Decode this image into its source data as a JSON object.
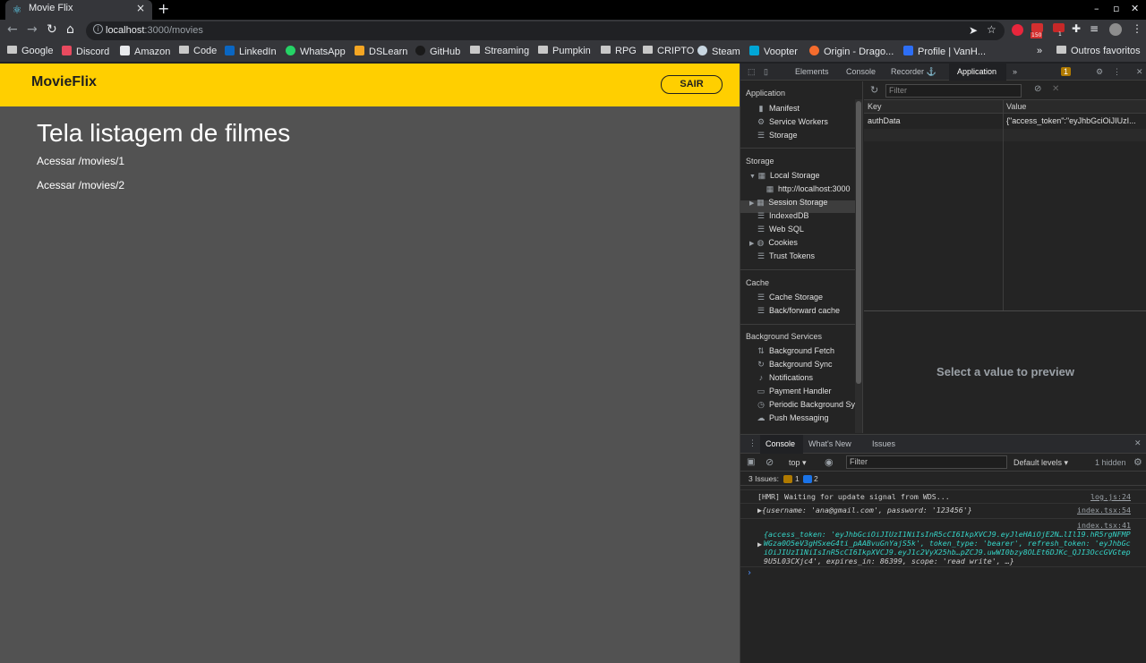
{
  "browser": {
    "tab_title": "Movie Flix",
    "new_tab": "+",
    "close_tab": "×",
    "url_host": "localhost",
    "url_path": ":3000/movies",
    "window_controls": [
      "–",
      "▫",
      "✕"
    ],
    "extension_badges": [
      "150",
      "1"
    ]
  },
  "bookmarks": [
    {
      "label": "Google",
      "icon": "folder"
    },
    {
      "label": "Discord",
      "icon": "discord-icon",
      "color": "#e84a5f"
    },
    {
      "label": "Amazon",
      "icon": "amazon-icon",
      "color": "#e8eaed"
    },
    {
      "label": "Code",
      "icon": "folder"
    },
    {
      "label": "LinkedIn",
      "icon": "linkedin-icon",
      "color": "#0a66c2"
    },
    {
      "label": "WhatsApp",
      "icon": "whatsapp-icon",
      "color": "#25d366"
    },
    {
      "label": "DSLearn",
      "icon": "bolt-icon",
      "color": "#f5a623"
    },
    {
      "label": "GitHub",
      "icon": "github-icon",
      "color": "#222"
    },
    {
      "label": "Streaming",
      "icon": "folder"
    },
    {
      "label": "Pumpkin",
      "icon": "folder"
    },
    {
      "label": "RPG",
      "icon": "folder"
    },
    {
      "label": "CRIPTO",
      "icon": "folder"
    },
    {
      "label": "Steam",
      "icon": "steam-icon",
      "color": "#1b2838"
    },
    {
      "label": "Voopter",
      "icon": "voopter-icon",
      "color": "#00a6d6"
    },
    {
      "label": "Origin - Drago...",
      "icon": "origin-icon",
      "color": "#f56c2d"
    },
    {
      "label": "Profile | VanH...",
      "icon": "vanh-icon",
      "color": "#2d6ef5"
    }
  ],
  "bookmarks_more": "»",
  "bookmarks_other": "Outros favoritos",
  "page": {
    "brand": "MovieFlix",
    "logout": "SAIR",
    "heading": "Tela listagem de filmes",
    "links": [
      "Acessar /movies/1",
      "Acessar /movies/2"
    ]
  },
  "devtools": {
    "tabs": [
      "Elements",
      "Console",
      "Recorder ⚓",
      "Application",
      "»"
    ],
    "issue_count": "1",
    "sidebar": {
      "application_title": "Application",
      "application_items": [
        "Manifest",
        "Service Workers",
        "Storage"
      ],
      "storage_title": "Storage",
      "storage_items": [
        "Local Storage",
        "http://localhost:3000",
        "Session Storage",
        "IndexedDB",
        "Web SQL",
        "Cookies",
        "Trust Tokens"
      ],
      "cache_title": "Cache",
      "cache_items": [
        "Cache Storage",
        "Back/forward cache"
      ],
      "background_title": "Background Services",
      "background_items": [
        "Background Fetch",
        "Background Sync",
        "Notifications",
        "Payment Handler",
        "Periodic Background Sync",
        "Push Messaging"
      ]
    },
    "storage_filter_placeholder": "Filter",
    "table_headers": [
      "Key",
      "Value"
    ],
    "rows": [
      {
        "key": "authData",
        "value": "{\"access_token\":\"eyJhbGciOiJIUzI..."
      }
    ],
    "preview_text": "Select a value to preview"
  },
  "console": {
    "tabs": [
      "Console",
      "What's New",
      "Issues"
    ],
    "context": "top ▾",
    "filter_placeholder": "Filter",
    "levels": "Default levels ▾",
    "hidden": "1 hidden",
    "issues_label": "3 Issues:",
    "issues_warn": "1",
    "issues_info": "2",
    "messages": [
      {
        "text": "[HMR] Waiting for update signal from WDS...",
        "source": "log.js:24"
      },
      {
        "text": "▶{username: 'ana@gmail.com', password: '123456'}",
        "source": "index.tsx:54"
      },
      {
        "source": "index.tsx:41"
      }
    ],
    "token_lines": [
      "{access_token: 'eyJhbGciOiJIUzI1NiIsInR5cCI6IkpXVCJ9.eyJleHAiOjE2N…lIl19.hR5rgNFMP",
      "WGza0O5eV3gHSxeG4ti_pAABvuGnYajS5k', token_type: 'bearer', refresh_token: 'eyJhbGc",
      "iOiJIUzI1NiIsInR5cCI6IkpXVCJ9.eyJ1c2VyX25hb…pZCJ9.uwWI0bzy8OLEt6DJKc_QJI3OccGVGtep",
      "9U5L03CXjc4', expires_in: 86399, scope: 'read write', …}"
    ],
    "prompt": "›"
  }
}
